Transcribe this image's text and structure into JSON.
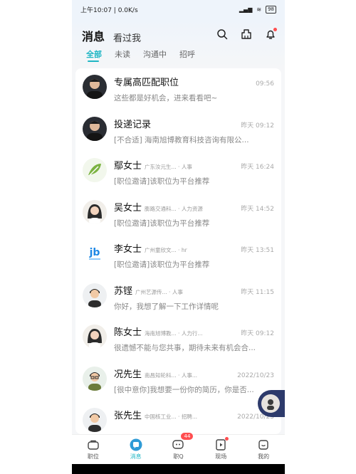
{
  "status": {
    "time": "上午10:07 | 0.0K/s",
    "battery": "98"
  },
  "header": {
    "tab_active": "消息",
    "tab_inactive": "看过我"
  },
  "subtabs": [
    "全部",
    "未读",
    "沟通中",
    "招呼"
  ],
  "messages": [
    {
      "name": "专属高匹配职位",
      "company": "",
      "time": "09:56",
      "preview": "这些都是好机会，进来看看吧~",
      "avatar": "person-icon"
    },
    {
      "name": "投递记录",
      "company": "",
      "time": "昨天 09:12",
      "preview": "[不合适] 海南旭博教育科技咨询有限公...",
      "avatar": "person-icon"
    },
    {
      "name": "鄢女士",
      "company": "广东汝元生... · 人事",
      "time": "昨天 16:24",
      "preview": "[职位邀请]该职位为平台推荐",
      "avatar": "leaf-logo-icon"
    },
    {
      "name": "吴女士",
      "company": "膨路交通科... · 人力资源",
      "time": "昨天 14:52",
      "preview": "[职位邀请]该职位为平台推荐",
      "avatar": "woman-icon"
    },
    {
      "name": "李女士",
      "company": "广州童欣文... · hr",
      "time": "昨天 13:51",
      "preview": "[职位邀请]该职位为平台推荐",
      "avatar": "jb-logo-icon"
    },
    {
      "name": "苏铿",
      "company": "广州艺源传... · 人事",
      "time": "昨天 11:15",
      "preview": "你好，我想了解一下工作详情呢",
      "avatar": "man-icon"
    },
    {
      "name": "陈女士",
      "company": "海南旭博教... · 人力行...",
      "time": "昨天 09:12",
      "preview": "很遗憾不能与您共事，期待未来有机会合...",
      "avatar": "woman-icon"
    },
    {
      "name": "况先生",
      "company": "南昌知轮科... · 人事...",
      "time": "2022/10/23",
      "preview": "[很中意你]我想要一份你的简历，你是否...",
      "avatar": "man-glasses-icon"
    },
    {
      "name": "张先生",
      "company": "中国核工业... · 招聘...",
      "time": "2022/10/23",
      "preview": "",
      "avatar": "man-icon"
    }
  ],
  "nav": [
    {
      "label": "职位",
      "icon": "briefcase-icon"
    },
    {
      "label": "消息",
      "icon": "chat-icon"
    },
    {
      "label": "职Q",
      "icon": "q-icon",
      "badge": "44"
    },
    {
      "label": "现场",
      "icon": "play-icon"
    },
    {
      "label": "我的",
      "icon": "profile-icon"
    }
  ],
  "colors": {
    "accent": "#1fb6c4",
    "badge": "#ff4d4f",
    "float": "#2d3a6b"
  }
}
